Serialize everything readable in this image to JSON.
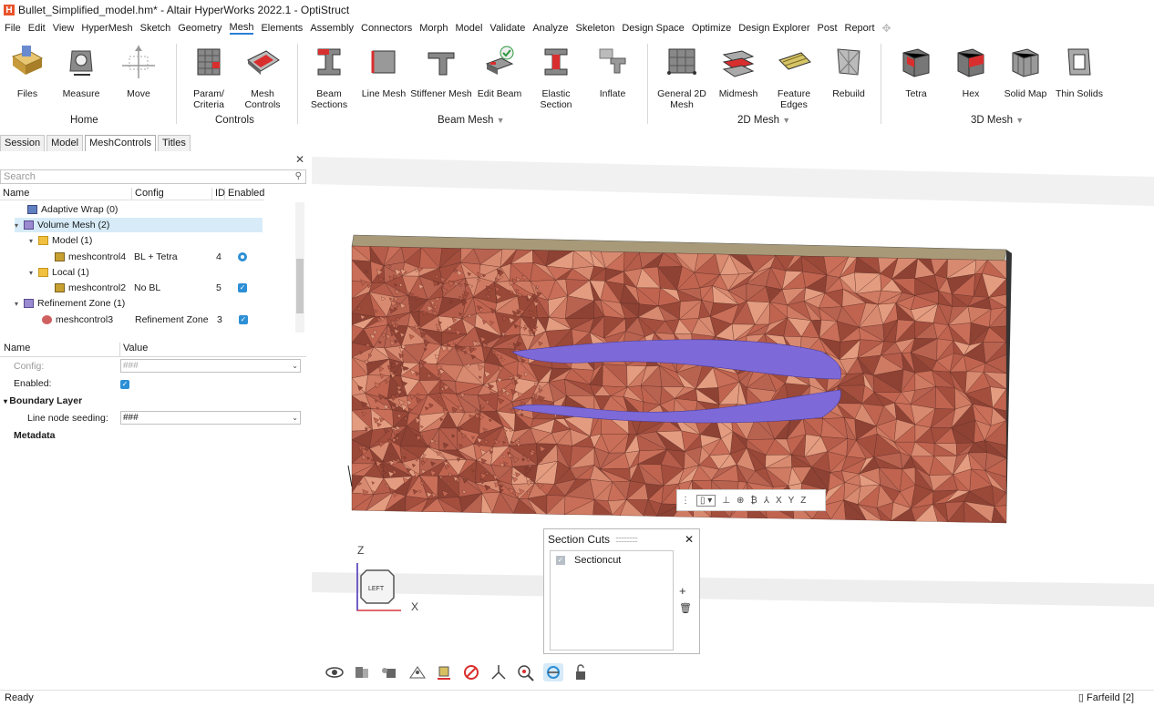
{
  "window": {
    "title": "Bullet_Simplified_model.hm* - Altair HyperWorks 2022.1 - OptiStruct"
  },
  "menu": [
    "File",
    "Edit",
    "View",
    "HyperMesh",
    "Sketch",
    "Geometry",
    "Mesh",
    "Elements",
    "Assembly",
    "Connectors",
    "Morph",
    "Model",
    "Validate",
    "Analyze",
    "Skeleton",
    "Design Space",
    "Optimize",
    "Design Explorer",
    "Post",
    "Report"
  ],
  "menu_active": "Mesh",
  "ribbon": {
    "buttons": {
      "files": "Files",
      "measure": "Measure",
      "move": "Move",
      "param_criteria": "Param/ Criteria",
      "mesh_controls": "Mesh Controls",
      "beam_sections": "Beam Sections",
      "line_mesh": "Line Mesh",
      "stiffener_mesh": "Stiffener Mesh",
      "edit_beam": "Edit Beam",
      "elastic_section": "Elastic Section",
      "inflate": "Inflate",
      "general_2d_mesh": "General 2D Mesh",
      "midmesh": "Midmesh",
      "feature_edges": "Feature Edges",
      "rebuild": "Rebuild",
      "tetra": "Tetra",
      "hex": "Hex",
      "solid_map": "Solid Map",
      "thin_solids": "Thin Solids"
    },
    "groups": {
      "home": "Home",
      "controls": "Controls",
      "beam_mesh": "Beam Mesh",
      "mesh_2d": "2D Mesh",
      "mesh_3d": "3D Mesh"
    }
  },
  "panel_tabs": [
    "Session",
    "Model",
    "MeshControls",
    "Titles"
  ],
  "panel_tab_active": "MeshControls",
  "search": {
    "placeholder": "Search"
  },
  "tree_columns": {
    "name": "Name",
    "config": "Config",
    "id": "ID",
    "enabled": "Enabled"
  },
  "tree": {
    "adaptive_wrap": "Adaptive Wrap  (0)",
    "volume_mesh": "Volume Mesh  (2)",
    "model": "Model  (1)",
    "meshcontrol4": {
      "name": "meshcontrol4",
      "config": "BL + Tetra",
      "id": "4"
    },
    "local": "Local  (1)",
    "meshcontrol2": {
      "name": "meshcontrol2",
      "config": "No BL",
      "id": "5"
    },
    "refinement_zone": "Refinement Zone  (1)",
    "meshcontrol3": {
      "name": "meshcontrol3",
      "config": "Refinement Zone",
      "id": "3"
    }
  },
  "properties": {
    "col_name": "Name",
    "col_value": "Value",
    "config_label": "Config:",
    "config_value": "###",
    "enabled_label": "Enabled:",
    "boundary_layer": "Boundary Layer",
    "line_node_seeding_label": "Line node seeding:",
    "line_node_seeding_value": "###",
    "metadata": "Metadata"
  },
  "section_cuts": {
    "title": "Section Cuts",
    "item": "Sectioncut"
  },
  "view_toolbar": {
    "x": "X",
    "y": "Y",
    "z": "Z"
  },
  "axis": {
    "z": "Z",
    "x": "X",
    "view": "LEFT"
  },
  "status": {
    "left": "Ready",
    "right": "Farfeild [2]"
  },
  "colors": {
    "accent": "#2d8fd5",
    "mesh": "#b25a48",
    "bl_layer": "#8a7ae0",
    "brand": "#e8542b"
  }
}
